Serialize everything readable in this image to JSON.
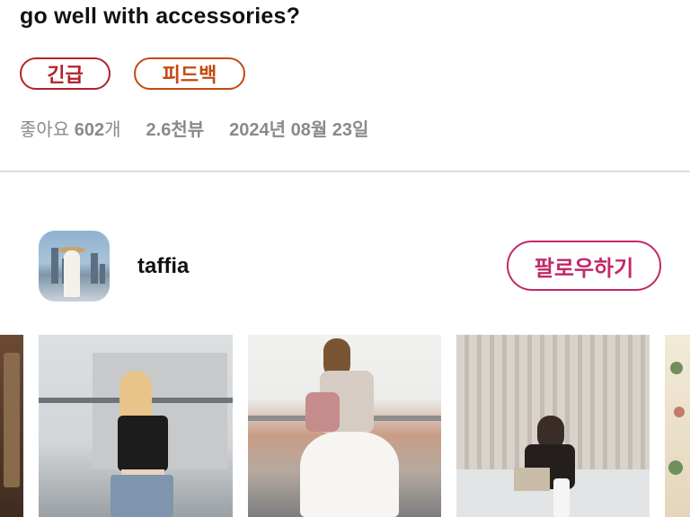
{
  "post": {
    "title_tail": "go well with accessories?",
    "tags": [
      "긴급",
      "피드백"
    ],
    "stats": {
      "likes_label": "좋아요",
      "likes_count": "602",
      "likes_unit": "개",
      "views": "2.6천뷰",
      "date": "2024년 08월 23일"
    }
  },
  "author": {
    "username": "taffia",
    "follow_label": "팔로우하기"
  },
  "colors": {
    "urgent": "#b3212a",
    "feedback": "#c34a12",
    "follow": "#c2286a",
    "meta_text": "#8a8a8a"
  }
}
